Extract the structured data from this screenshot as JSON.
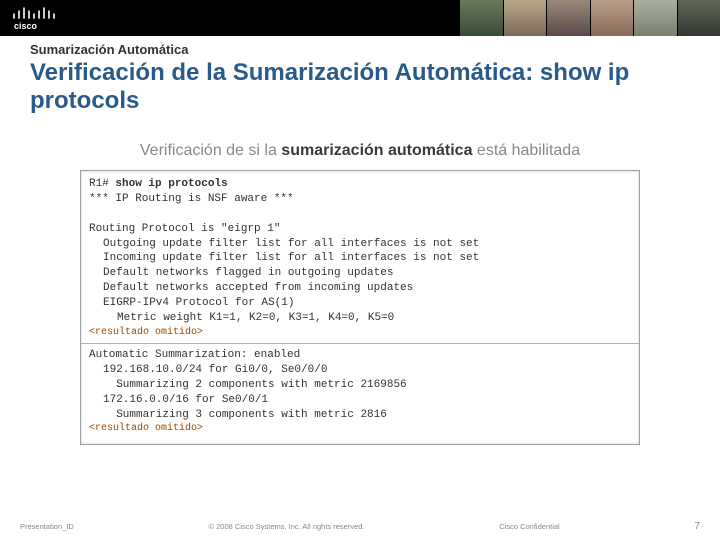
{
  "header": {
    "logo_label": "cisco"
  },
  "slide": {
    "pretitle": "Sumarización Automática",
    "title": "Verificación de la Sumarización Automática: show ip protocols",
    "subtitle_plain_a": "Verificación de si la ",
    "subtitle_bold": "sumarización automática",
    "subtitle_plain_b": " está habilitada"
  },
  "terminal": {
    "prompt": "R1# ",
    "command": "show ip protocols",
    "lines_top": [
      "*** IP Routing is NSF aware ***",
      "",
      "Routing Protocol is \"eigrp 1\""
    ],
    "lines_top_indent": [
      "Outgoing update filter list for all interfaces is not set",
      "Incoming update filter list for all interfaces is not set",
      "Default networks flagged in outgoing updates",
      "Default networks accepted from incoming updates",
      "EIGRP-IPv4 Protocol for AS(1)"
    ],
    "lines_top_indent2": [
      "Metric weight K1=1, K2=0, K3=1, K4=0, K5=0"
    ],
    "omitted": "<resultado omitido>",
    "lines_bottom": [
      "Automatic Summarization: enabled"
    ],
    "lines_bottom_indent": [
      "192.168.10.0/24 for Gi0/0, Se0/0/0",
      "  Summarizing 2 components with metric 2169856",
      "172.16.0.0/16 for Se0/0/1",
      "  Summarizing 3 components with metric 2816"
    ]
  },
  "footer": {
    "left": "Presentation_ID",
    "center": "© 2008 Cisco Systems, Inc. All rights reserved.",
    "right": "Cisco Confidential",
    "pagenum": "7"
  }
}
